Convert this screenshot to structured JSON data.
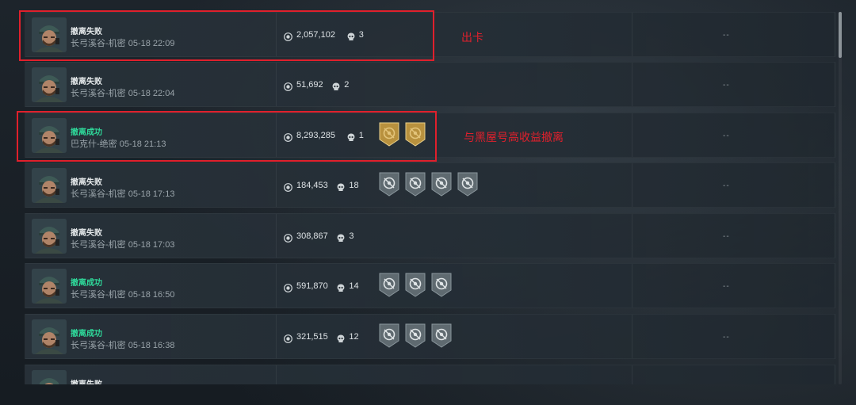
{
  "rows": [
    {
      "status": "撤离失败",
      "success": false,
      "map": "长弓溪谷-机密 05-18 22:09",
      "value": "2,057,102",
      "kills": "3",
      "badges": [],
      "extra": "--"
    },
    {
      "status": "撤离失败",
      "success": false,
      "map": "长弓溪谷-机密 05-18 22:04",
      "value": "51,692",
      "kills": "2",
      "badges": [],
      "extra": "--"
    },
    {
      "status": "撤离成功",
      "success": true,
      "map": "巴克什-绝密 05-18 21:13",
      "value": "8,293,285",
      "kills": "1",
      "badges": [
        "gold-badge-icon",
        "gold-badge-icon"
      ],
      "extra": "--"
    },
    {
      "status": "撤离失败",
      "success": false,
      "map": "长弓溪谷-机密 05-18 17:13",
      "value": "184,453",
      "kills": "18",
      "badges": [
        "grey-badge-icon",
        "grey-badge-icon",
        "grey-badge-icon",
        "grey-badge-icon"
      ],
      "extra": "--"
    },
    {
      "status": "撤离失败",
      "success": false,
      "map": "长弓溪谷-机密 05-18 17:03",
      "value": "308,867",
      "kills": "3",
      "badges": [],
      "extra": "--"
    },
    {
      "status": "撤离成功",
      "success": true,
      "map": "长弓溪谷-机密 05-18 16:50",
      "value": "591,870",
      "kills": "14",
      "badges": [
        "grey-badge-icon",
        "grey-badge-icon",
        "grey-badge-icon"
      ],
      "extra": "--"
    },
    {
      "status": "撤离成功",
      "success": true,
      "map": "长弓溪谷-机密 05-18 16:38",
      "value": "321,515",
      "kills": "12",
      "badges": [
        "grey-badge-icon",
        "grey-badge-icon",
        "grey-badge-icon"
      ],
      "extra": "--"
    },
    {
      "status": "撤离失败",
      "success": false,
      "map": "",
      "value": "",
      "kills": "",
      "badges": [],
      "extra": ""
    }
  ],
  "annotations": {
    "first": "出卡",
    "second": "与黑屋号高收益撤离"
  },
  "colors": {
    "success": "#2fd89a",
    "failure": "#e4e8ea",
    "highlight": "#e0202c",
    "gold_badge": "#c9a54a",
    "grey_badge": "#6f7a80"
  }
}
